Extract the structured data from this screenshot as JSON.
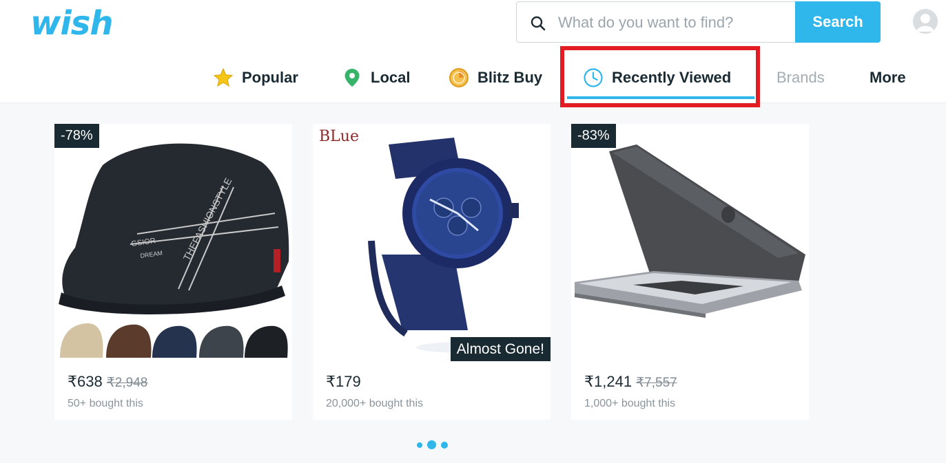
{
  "header": {
    "logo": "wish",
    "search": {
      "placeholder": "What do you want to find?",
      "value": "",
      "button_label": "Search"
    }
  },
  "nav": {
    "items": [
      {
        "label": "Popular",
        "icon": "star-icon"
      },
      {
        "label": "Local",
        "icon": "location-pin-icon"
      },
      {
        "label": "Blitz Buy",
        "icon": "blitz-buy-icon"
      },
      {
        "label": "Recently Viewed",
        "icon": "clock-icon",
        "active": true
      },
      {
        "label": "Brands"
      },
      {
        "label": "More"
      }
    ]
  },
  "products": [
    {
      "discount": "-78%",
      "price": "₹638",
      "original_price": "₹2,948",
      "bought": "50+ bought this",
      "image": "flat-cap"
    },
    {
      "image_label": "BLue",
      "badge": "Almost Gone!",
      "price": "₹179",
      "bought": "20,000+ bought this",
      "image": "blue-watch"
    },
    {
      "discount": "-83%",
      "price": "₹1,241",
      "original_price": "₹7,557",
      "bought": "1,000+ bought this",
      "image": "laptop-case"
    }
  ],
  "carousel": {
    "pages": 3,
    "current": 2
  },
  "colors": {
    "accent": "#2fb7ec",
    "text": "#192a32",
    "highlight": "#e31b23"
  }
}
